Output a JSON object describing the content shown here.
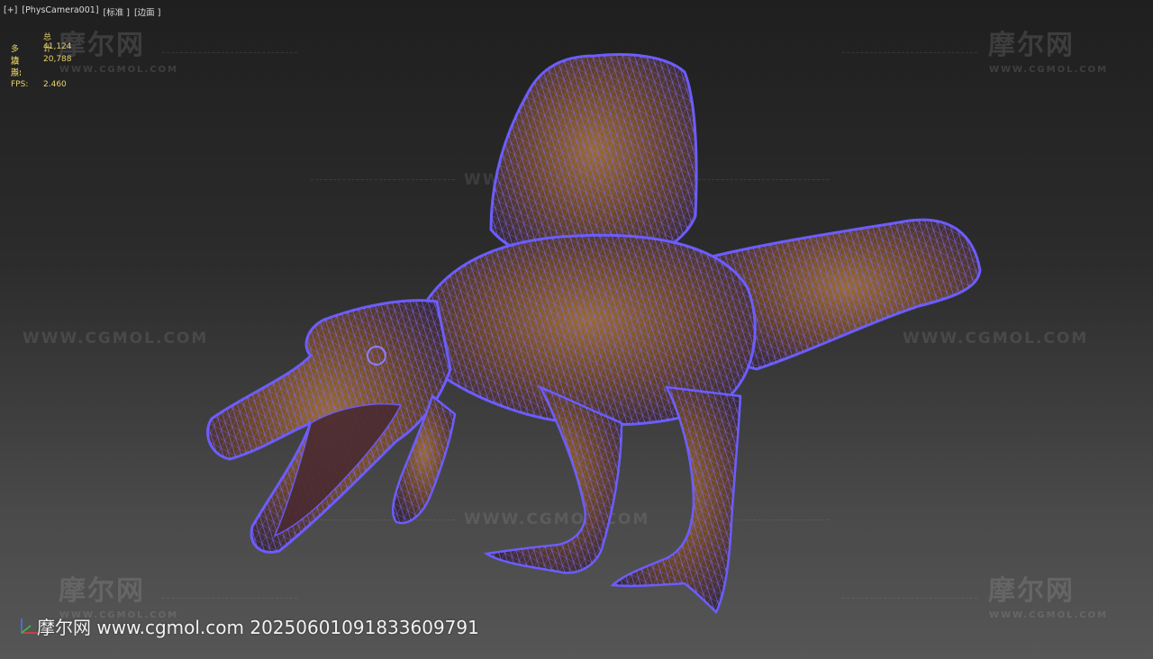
{
  "viewport": {
    "menu_plus": "[+]",
    "camera": "[PhysCamera001]",
    "shading": "[标准 ]",
    "render_mode": "[边面 ]"
  },
  "stats": {
    "header": "总计",
    "polygons_label": "多边形:",
    "polygons_value": "41,124",
    "vertices_label": "顶点:",
    "vertices_value": "20,788",
    "fps_label": "FPS:",
    "fps_value": "2.460"
  },
  "watermark": {
    "logo_text": "摩尔网",
    "logo_sub": "WWW.CGMOL.COM",
    "url_text": "WWW.CGMOL.COM"
  },
  "footer": {
    "caption": "摩尔网 www.cgmol.com 20250601091833609791"
  },
  "colors": {
    "wireframe": "#6a5cff",
    "skin": "#8a5a2a",
    "stats_text": "#e8d36a"
  }
}
